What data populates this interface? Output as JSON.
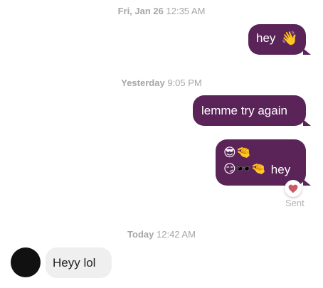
{
  "thread": {
    "stamp_1": {
      "day": "Fri, Jan 26",
      "time": "12:35 AM"
    },
    "msg_1": {
      "text": "hey",
      "emoji": "👋"
    },
    "stamp_2": {
      "day": "Yesterday",
      "time": "9:05 PM"
    },
    "msg_2": {
      "text": "lemme try again"
    },
    "msg_3": {
      "line1_emoji": "😎🤏",
      "line2_emoji": "😏🕶️🤏",
      "text": "hey"
    },
    "reaction": {
      "icon": "heart-icon",
      "color": "#c85a6a"
    },
    "status": "Sent",
    "stamp_3": {
      "day": "Today",
      "time": "12:42 AM"
    },
    "msg_4": {
      "text": "Heyy lol"
    }
  },
  "colors": {
    "outgoing_bubble": "#5b2459",
    "incoming_bubble": "#efefef",
    "timestamp": "#a6a6a6"
  }
}
